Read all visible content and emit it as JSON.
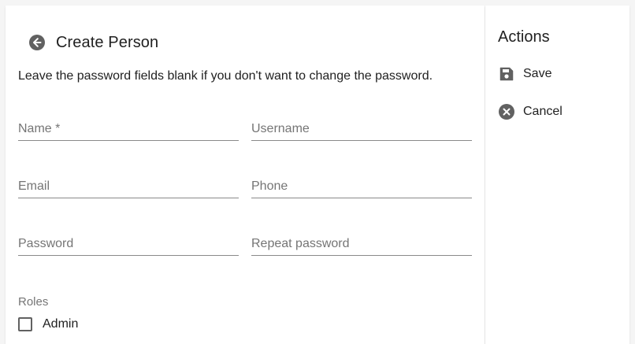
{
  "header": {
    "title": "Create Person",
    "back_icon": "arrow-left-circle-icon"
  },
  "hint": "Leave the password fields blank if you don't want to change the password.",
  "form": {
    "name_placeholder": "Name *",
    "name_value": "",
    "username_placeholder": "Username",
    "username_value": "",
    "email_placeholder": "Email",
    "email_value": "",
    "phone_placeholder": "Phone",
    "phone_value": "",
    "password_placeholder": "Password",
    "password_value": "",
    "repeat_password_placeholder": "Repeat password",
    "repeat_password_value": ""
  },
  "roles": {
    "label": "Roles",
    "options": [
      {
        "label": "Admin",
        "checked": false
      }
    ]
  },
  "actions": {
    "title": "Actions",
    "save_label": "Save",
    "save_icon": "floppy-disk-icon",
    "cancel_label": "Cancel",
    "cancel_icon": "close-circle-icon"
  },
  "colors": {
    "icon": "#616161",
    "text": "#212121",
    "muted": "#757575",
    "background": "#f5f5f5",
    "card": "#ffffff"
  }
}
